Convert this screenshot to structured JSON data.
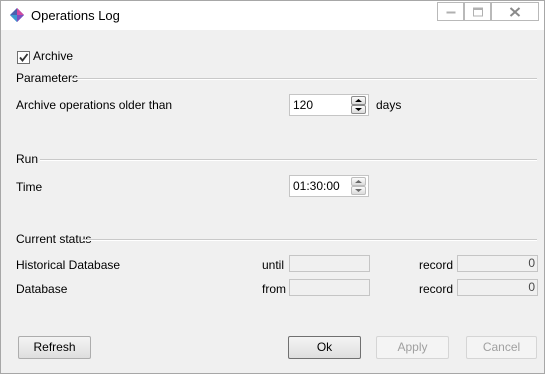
{
  "window": {
    "title": "Operations Log",
    "icon": "app-diamond-icon"
  },
  "archive": {
    "label": "Archive",
    "checked": true
  },
  "parameters": {
    "section_label": "Parameters",
    "older_than_label": "Archive operations older than",
    "older_than_value": "120",
    "unit_label": "days"
  },
  "run": {
    "section_label": "Run",
    "time_label": "Time",
    "time_value": "01:30:00"
  },
  "status": {
    "section_label": "Current status",
    "rows": [
      {
        "label": "Historical Database",
        "range_label": "until",
        "range_value": "",
        "record_label": "record",
        "record_value": "0"
      },
      {
        "label": "Database",
        "range_label": "from",
        "range_value": "",
        "record_label": "record",
        "record_value": "0"
      }
    ]
  },
  "buttons": {
    "refresh": "Refresh",
    "ok": "Ok",
    "apply": "Apply",
    "cancel": "Cancel"
  }
}
